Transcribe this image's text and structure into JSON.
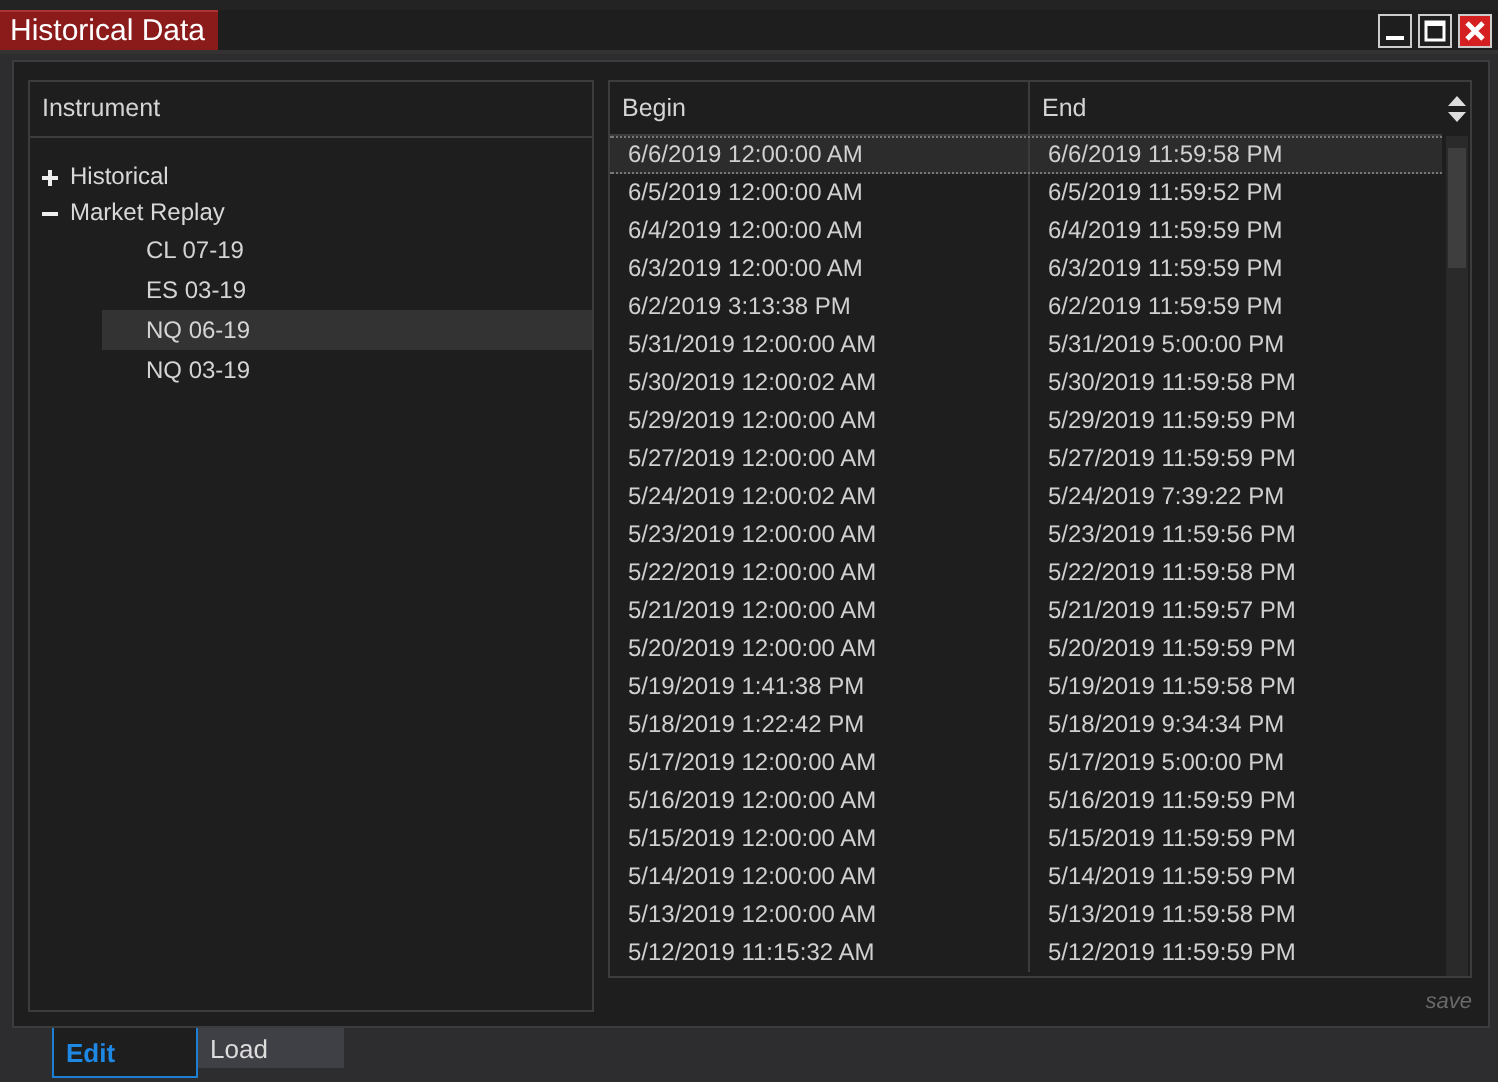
{
  "window": {
    "title": "Historical Data"
  },
  "instrument_tree": {
    "heading": "Instrument",
    "items": [
      {
        "label": "Historical",
        "expanded": false,
        "selected": false
      },
      {
        "label": "Market Replay",
        "expanded": true,
        "selected": false,
        "children": [
          {
            "label": "CL 07-19",
            "selected": false
          },
          {
            "label": "ES 03-19",
            "selected": false
          },
          {
            "label": "NQ 06-19",
            "selected": true
          },
          {
            "label": "NQ 03-19",
            "selected": false
          }
        ]
      }
    ]
  },
  "table": {
    "columns": [
      "Begin",
      "End"
    ],
    "rows": [
      {
        "cells": [
          "6/6/2019 12:00:00 AM",
          "6/6/2019 11:59:58 PM"
        ],
        "selected": true
      },
      {
        "cells": [
          "6/5/2019 12:00:00 AM",
          "6/5/2019 11:59:52 PM"
        ],
        "selected": false
      },
      {
        "cells": [
          "6/4/2019 12:00:00 AM",
          "6/4/2019 11:59:59 PM"
        ],
        "selected": false
      },
      {
        "cells": [
          "6/3/2019 12:00:00 AM",
          "6/3/2019 11:59:59 PM"
        ],
        "selected": false
      },
      {
        "cells": [
          "6/2/2019 3:13:38 PM",
          "6/2/2019 11:59:59 PM"
        ],
        "selected": false
      },
      {
        "cells": [
          "5/31/2019 12:00:00 AM",
          "5/31/2019 5:00:00 PM"
        ],
        "selected": false
      },
      {
        "cells": [
          "5/30/2019 12:00:02 AM",
          "5/30/2019 11:59:58 PM"
        ],
        "selected": false
      },
      {
        "cells": [
          "5/29/2019 12:00:00 AM",
          "5/29/2019 11:59:59 PM"
        ],
        "selected": false
      },
      {
        "cells": [
          "5/27/2019 12:00:00 AM",
          "5/27/2019 11:59:59 PM"
        ],
        "selected": false
      },
      {
        "cells": [
          "5/24/2019 12:00:02 AM",
          "5/24/2019 7:39:22 PM"
        ],
        "selected": false
      },
      {
        "cells": [
          "5/23/2019 12:00:00 AM",
          "5/23/2019 11:59:56 PM"
        ],
        "selected": false
      },
      {
        "cells": [
          "5/22/2019 12:00:00 AM",
          "5/22/2019 11:59:58 PM"
        ],
        "selected": false
      },
      {
        "cells": [
          "5/21/2019 12:00:00 AM",
          "5/21/2019 11:59:57 PM"
        ],
        "selected": false
      },
      {
        "cells": [
          "5/20/2019 12:00:00 AM",
          "5/20/2019 11:59:59 PM"
        ],
        "selected": false
      },
      {
        "cells": [
          "5/19/2019 1:41:38 PM",
          "5/19/2019 11:59:58 PM"
        ],
        "selected": false
      },
      {
        "cells": [
          "5/18/2019 1:22:42 PM",
          "5/18/2019 9:34:34 PM"
        ],
        "selected": false
      },
      {
        "cells": [
          "5/17/2019 12:00:00 AM",
          "5/17/2019 5:00:00 PM"
        ],
        "selected": false
      },
      {
        "cells": [
          "5/16/2019 12:00:00 AM",
          "5/16/2019 11:59:59 PM"
        ],
        "selected": false
      },
      {
        "cells": [
          "5/15/2019 12:00:00 AM",
          "5/15/2019 11:59:59 PM"
        ],
        "selected": false
      },
      {
        "cells": [
          "5/14/2019 12:00:00 AM",
          "5/14/2019 11:59:59 PM"
        ],
        "selected": false
      },
      {
        "cells": [
          "5/13/2019 12:00:00 AM",
          "5/13/2019 11:59:58 PM"
        ],
        "selected": false
      },
      {
        "cells": [
          "5/12/2019 11:15:32 AM",
          "5/12/2019 11:59:59 PM"
        ],
        "selected": false
      }
    ]
  },
  "save_button": "save",
  "tabs": [
    {
      "label": "Edit",
      "selected": true
    },
    {
      "label": "Load",
      "selected": false
    }
  ]
}
